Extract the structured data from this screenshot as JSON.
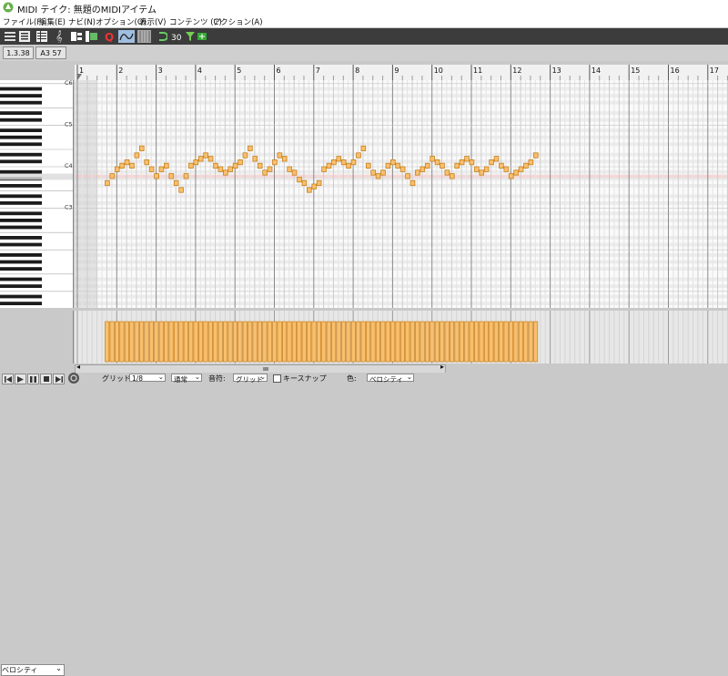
{
  "window": {
    "title": "MIDI テイク: 無題のMIDIアイテム",
    "app_icon": "reaper-logo-icon"
  },
  "menu": [
    "ファイル(F)",
    "編集(E)",
    "ナビ(N)",
    "オプション(O)",
    "表示(V)",
    "コンテンツ (C)",
    "アクション(A)"
  ],
  "toolbar": {
    "icons": [
      "piano-roll-mode-icon",
      "named-notes-mode-icon",
      "event-list-mode-icon",
      "notation-mode-icon",
      "chord-icon",
      "step-input-icon",
      "quantize-icon",
      "snap-grid-icon",
      "grid-toggle-icon",
      "loop-icon",
      "scale-icon",
      "filter-icon",
      "sync-icon"
    ]
  },
  "info": {
    "position": "1.3.38",
    "note": "A3  57"
  },
  "ruler": {
    "measures": [
      "1",
      "2",
      "3",
      "4",
      "5",
      "6",
      "7",
      "8",
      "9",
      "10",
      "11",
      "12",
      "13",
      "14",
      "15",
      "16",
      "17"
    ]
  },
  "keyboard": {
    "octave_labels": [
      "C6",
      "C5",
      "C4",
      "C3"
    ]
  },
  "notes": {
    "color": "#f8bf6e",
    "border": "#c7801c",
    "pitches": [
      55,
      57,
      59,
      60,
      61,
      60,
      63,
      65,
      61,
      59,
      57,
      59,
      60,
      57,
      55,
      53,
      57,
      60,
      61,
      62,
      63,
      62,
      60,
      59,
      58,
      59,
      60,
      61,
      63,
      65,
      62,
      60,
      58,
      59,
      61,
      63,
      62,
      59,
      58,
      56,
      55,
      53,
      54,
      55,
      59,
      60,
      61,
      62,
      61,
      60,
      61,
      63,
      65,
      60,
      58,
      57,
      58,
      60,
      61,
      60,
      59,
      57,
      55,
      58,
      59,
      60,
      62,
      61,
      60,
      58,
      57,
      60,
      61,
      62,
      61,
      59,
      58,
      59,
      61,
      62,
      60,
      59,
      57,
      58,
      59,
      60,
      61,
      63
    ]
  },
  "velocity": {
    "lane_label": "ベロシティ"
  },
  "bottom": {
    "grid_label": "グリッド:",
    "grid_value": "1/8",
    "mode_value": "通常",
    "notes_label": "音符:",
    "notes_value": "グリッド",
    "key_snap_label": "キースナップ",
    "key_snap_checked": false,
    "color_label": "色:",
    "color_value": "ベロシティ"
  }
}
